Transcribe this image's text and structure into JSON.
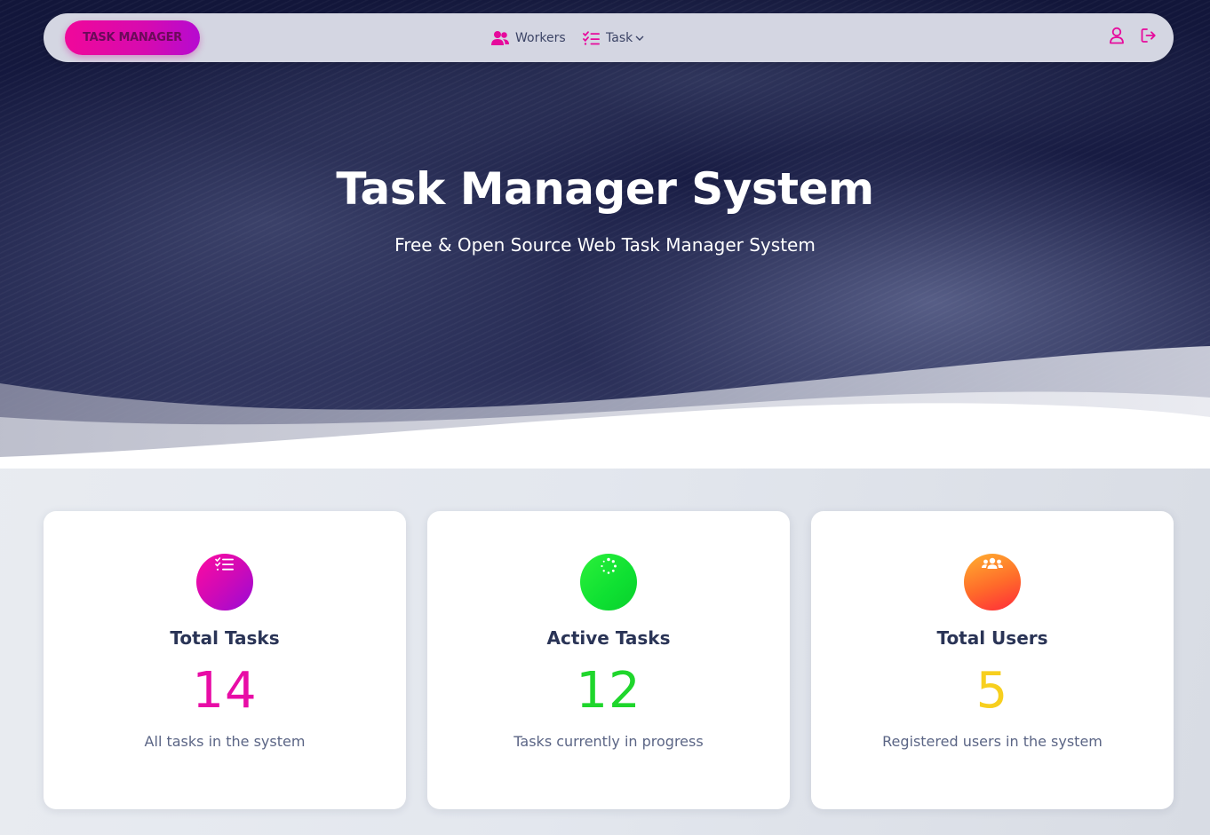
{
  "navbar": {
    "brand": "TASK MANAGER",
    "items": [
      {
        "label": "Workers",
        "icon": "users-icon"
      },
      {
        "label": "Task",
        "icon": "task-list-icon"
      }
    ],
    "right_icons": [
      "user-icon",
      "logout-icon"
    ]
  },
  "hero": {
    "title": "Task Manager System",
    "subtitle": "Free & Open Source Web Task Manager System"
  },
  "cards": [
    {
      "title": "Total Tasks",
      "value": "14",
      "description": "All tasks in the system",
      "icon": "task-list-icon",
      "accent": "#e80ca6"
    },
    {
      "title": "Active Tasks",
      "value": "12",
      "description": "Tasks currently in progress",
      "icon": "spinner-icon",
      "accent": "#1fd62c"
    },
    {
      "title": "Total Users",
      "value": "5",
      "description": "Registered users in the system",
      "icon": "users-group-icon",
      "accent": "#f7cf1e"
    }
  ],
  "colors": {
    "brand_pink": "#f0089a",
    "nav_bg": "#d4d6e2",
    "hero_dark": "#12163a"
  }
}
